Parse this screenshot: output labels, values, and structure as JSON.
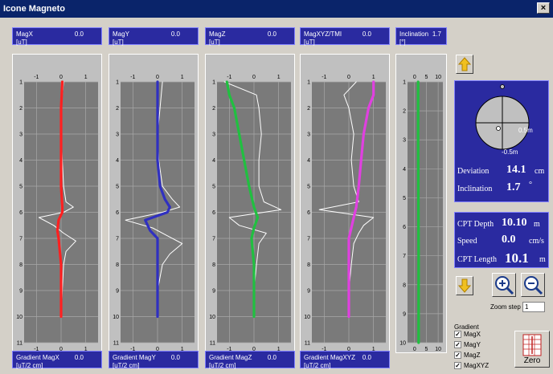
{
  "window": {
    "title": "Icone Magneto",
    "close_label": "×"
  },
  "readouts": [
    {
      "label": "MagX",
      "value": "0.0",
      "unit": "[uT]"
    },
    {
      "label": "MagY",
      "value": "0.0",
      "unit": "[uT]"
    },
    {
      "label": "MagZ",
      "value": "0.0",
      "unit": "[uT]"
    },
    {
      "label": "MagXYZ/TMI",
      "value": "0.0",
      "unit": "[uT]"
    },
    {
      "label": "Inclination",
      "value": "1.7",
      "unit": "[°]"
    }
  ],
  "gradient_readouts": [
    {
      "label": "Gradient MagX",
      "value": "0.0",
      "unit": "[uT/2 cm]"
    },
    {
      "label": "Gradient MagY",
      "value": "0.0",
      "unit": "[uT/2 cm]"
    },
    {
      "label": "Gradient MagZ",
      "value": "0.0",
      "unit": "[uT/2 cm]"
    },
    {
      "label": "Gradient MagXYZ",
      "value": "0.0",
      "unit": "[uT/2 cm]"
    }
  ],
  "deviation_panel": {
    "ring_label_outer": "0.5m",
    "ring_label_inner": "-0.5m",
    "deviation_label": "Deviation",
    "deviation_value": "14.1",
    "deviation_unit": "cm",
    "inclination_label": "Inclination",
    "inclination_value": "1.7",
    "inclination_unit": "°"
  },
  "cpt_panel": {
    "depth_label": "CPT Depth",
    "depth_value": "10.10",
    "depth_unit": "m",
    "speed_label": "Speed",
    "speed_value": "0.0",
    "speed_unit": "cm/s",
    "length_label": "CPT Length",
    "length_value": "10.1",
    "length_unit": "m"
  },
  "zoom": {
    "label": "Zoom step",
    "value": "1"
  },
  "gradient_options": {
    "title": "Gradient",
    "items": [
      {
        "label": "MagX",
        "checked": true
      },
      {
        "label": "MagY",
        "checked": true
      },
      {
        "label": "MagZ",
        "checked": true
      },
      {
        "label": "MagXYZ",
        "checked": true
      }
    ]
  },
  "zero_button": {
    "label": "Zero"
  },
  "colors": {
    "magx": "#ff2020",
    "magy": "#3030c0",
    "magz": "#20c040",
    "magxyz": "#e040e0",
    "incl": "#20c040",
    "white": "#ffffff"
  },
  "chart_data": [
    {
      "type": "line",
      "name": "MagX",
      "x_ticks": [
        "-1",
        "0",
        "1"
      ],
      "y_ticks": [
        "1",
        "2",
        "3",
        "4",
        "5",
        "6",
        "7",
        "8",
        "9",
        "10",
        "11"
      ],
      "xlim": [
        -1.5,
        1.5
      ],
      "ylim": [
        1,
        11
      ],
      "series": [
        {
          "color": "#ff2020",
          "depth": [
            1,
            2,
            3,
            4,
            5,
            5.8,
            6,
            6.3,
            6.7,
            7,
            8,
            9,
            10
          ],
          "values": [
            0.05,
            0.0,
            0.0,
            0.0,
            0.0,
            0.05,
            0.05,
            -0.1,
            -0.15,
            -0.1,
            0.0,
            0.0,
            0.0
          ]
        },
        {
          "color": "#ffffff",
          "depth": [
            1,
            2,
            3,
            4,
            5,
            5.6,
            5.8,
            6.0,
            6.2,
            6.5,
            6.8,
            7.1,
            7.5,
            8,
            9,
            10
          ],
          "values": [
            0.1,
            0.0,
            0.0,
            0.05,
            0.1,
            0.2,
            0.5,
            0.1,
            -0.9,
            -0.3,
            0.1,
            0.6,
            0.2,
            0.1,
            0.05,
            0.0
          ]
        }
      ]
    },
    {
      "type": "line",
      "name": "MagY",
      "x_ticks": [
        "-1",
        "0",
        "1"
      ],
      "y_ticks": [
        "1",
        "2",
        "3",
        "4",
        "5",
        "6",
        "7",
        "8",
        "9",
        "10",
        "11"
      ],
      "xlim": [
        -1.5,
        1.5
      ],
      "ylim": [
        1,
        11
      ],
      "series": [
        {
          "color": "#3030c0",
          "depth": [
            1,
            2,
            3,
            4,
            5,
            5.5,
            5.8,
            6.0,
            6.3,
            6.7,
            7,
            8,
            9,
            10
          ],
          "values": [
            0.0,
            0.0,
            0.0,
            0.0,
            0.1,
            0.3,
            0.5,
            0.4,
            -0.5,
            -0.3,
            0.0,
            0.0,
            0.0,
            0.0
          ]
        },
        {
          "color": "#ffffff",
          "depth": [
            1,
            2,
            3,
            4,
            5,
            5.5,
            5.8,
            6.0,
            6.3,
            6.6,
            6.9,
            7.2,
            7.6,
            8,
            9,
            10
          ],
          "values": [
            0.2,
            0.1,
            0.0,
            0.05,
            0.2,
            0.6,
            0.9,
            0.2,
            -1.3,
            -0.2,
            0.4,
            1.0,
            0.5,
            0.2,
            0.0,
            0.0
          ]
        }
      ]
    },
    {
      "type": "line",
      "name": "MagZ",
      "x_ticks": [
        "-1",
        "0",
        "1"
      ],
      "y_ticks": [
        "1",
        "2",
        "3",
        "4",
        "5",
        "6",
        "7",
        "8",
        "9",
        "10",
        "11"
      ],
      "xlim": [
        -1.5,
        1.5
      ],
      "ylim": [
        1,
        11
      ],
      "series": [
        {
          "color": "#20c040",
          "depth": [
            1,
            1.5,
            2,
            3,
            4,
            5,
            5.8,
            6.2,
            6.6,
            7,
            8,
            9,
            10
          ],
          "values": [
            -1.1,
            -1.0,
            -0.8,
            -0.6,
            -0.4,
            -0.2,
            0.0,
            0.15,
            0.0,
            -0.1,
            0.0,
            0.0,
            0.0
          ]
        },
        {
          "color": "#ffffff",
          "depth": [
            1,
            1.5,
            2,
            3,
            4,
            5,
            5.6,
            5.9,
            6.2,
            6.5,
            6.8,
            7.2,
            8,
            9,
            10
          ],
          "values": [
            -1.2,
            0.1,
            0.2,
            0.3,
            0.2,
            0.2,
            0.4,
            1.1,
            -1.0,
            -0.6,
            0.5,
            0.2,
            0.1,
            0.0,
            0.0
          ]
        }
      ]
    },
    {
      "type": "line",
      "name": "MagXYZ/TMI",
      "x_ticks": [
        "-1",
        "0",
        "1"
      ],
      "y_ticks": [
        "1",
        "2",
        "3",
        "4",
        "5",
        "6",
        "7",
        "8",
        "9",
        "10",
        "11"
      ],
      "xlim": [
        -1.5,
        1.5
      ],
      "ylim": [
        1,
        11
      ],
      "series": [
        {
          "color": "#e040e0",
          "depth": [
            1,
            1.5,
            2,
            3,
            4,
            5,
            5.8,
            6.2,
            6.6,
            7,
            8,
            9,
            10
          ],
          "values": [
            1.0,
            1.0,
            0.8,
            0.6,
            0.5,
            0.4,
            0.3,
            0.2,
            0.1,
            0.0,
            0.0,
            0.0,
            0.0
          ]
        },
        {
          "color": "#ffffff",
          "depth": [
            1,
            1.5,
            2,
            3,
            4,
            5,
            5.6,
            5.9,
            6.2,
            6.5,
            6.8,
            7.2,
            8,
            9,
            10
          ],
          "values": [
            0.3,
            -0.2,
            0.0,
            0.2,
            0.1,
            0.2,
            0.4,
            -1.2,
            1.0,
            0.6,
            0.4,
            0.2,
            0.1,
            0.0,
            0.0
          ]
        }
      ]
    },
    {
      "type": "line",
      "name": "Inclination",
      "x_ticks": [
        "0",
        "5",
        "10"
      ],
      "y_ticks": [
        "1",
        "2",
        "3",
        "4",
        "5",
        "6",
        "7",
        "8",
        "9",
        "10"
      ],
      "xlim": [
        -3,
        12
      ],
      "ylim": [
        1,
        10
      ],
      "series": [
        {
          "color": "#20c040",
          "depth": [
            1,
            3,
            5,
            7,
            9,
            10
          ],
          "values": [
            1.5,
            1.5,
            1.6,
            1.7,
            1.7,
            1.7
          ]
        }
      ]
    }
  ]
}
